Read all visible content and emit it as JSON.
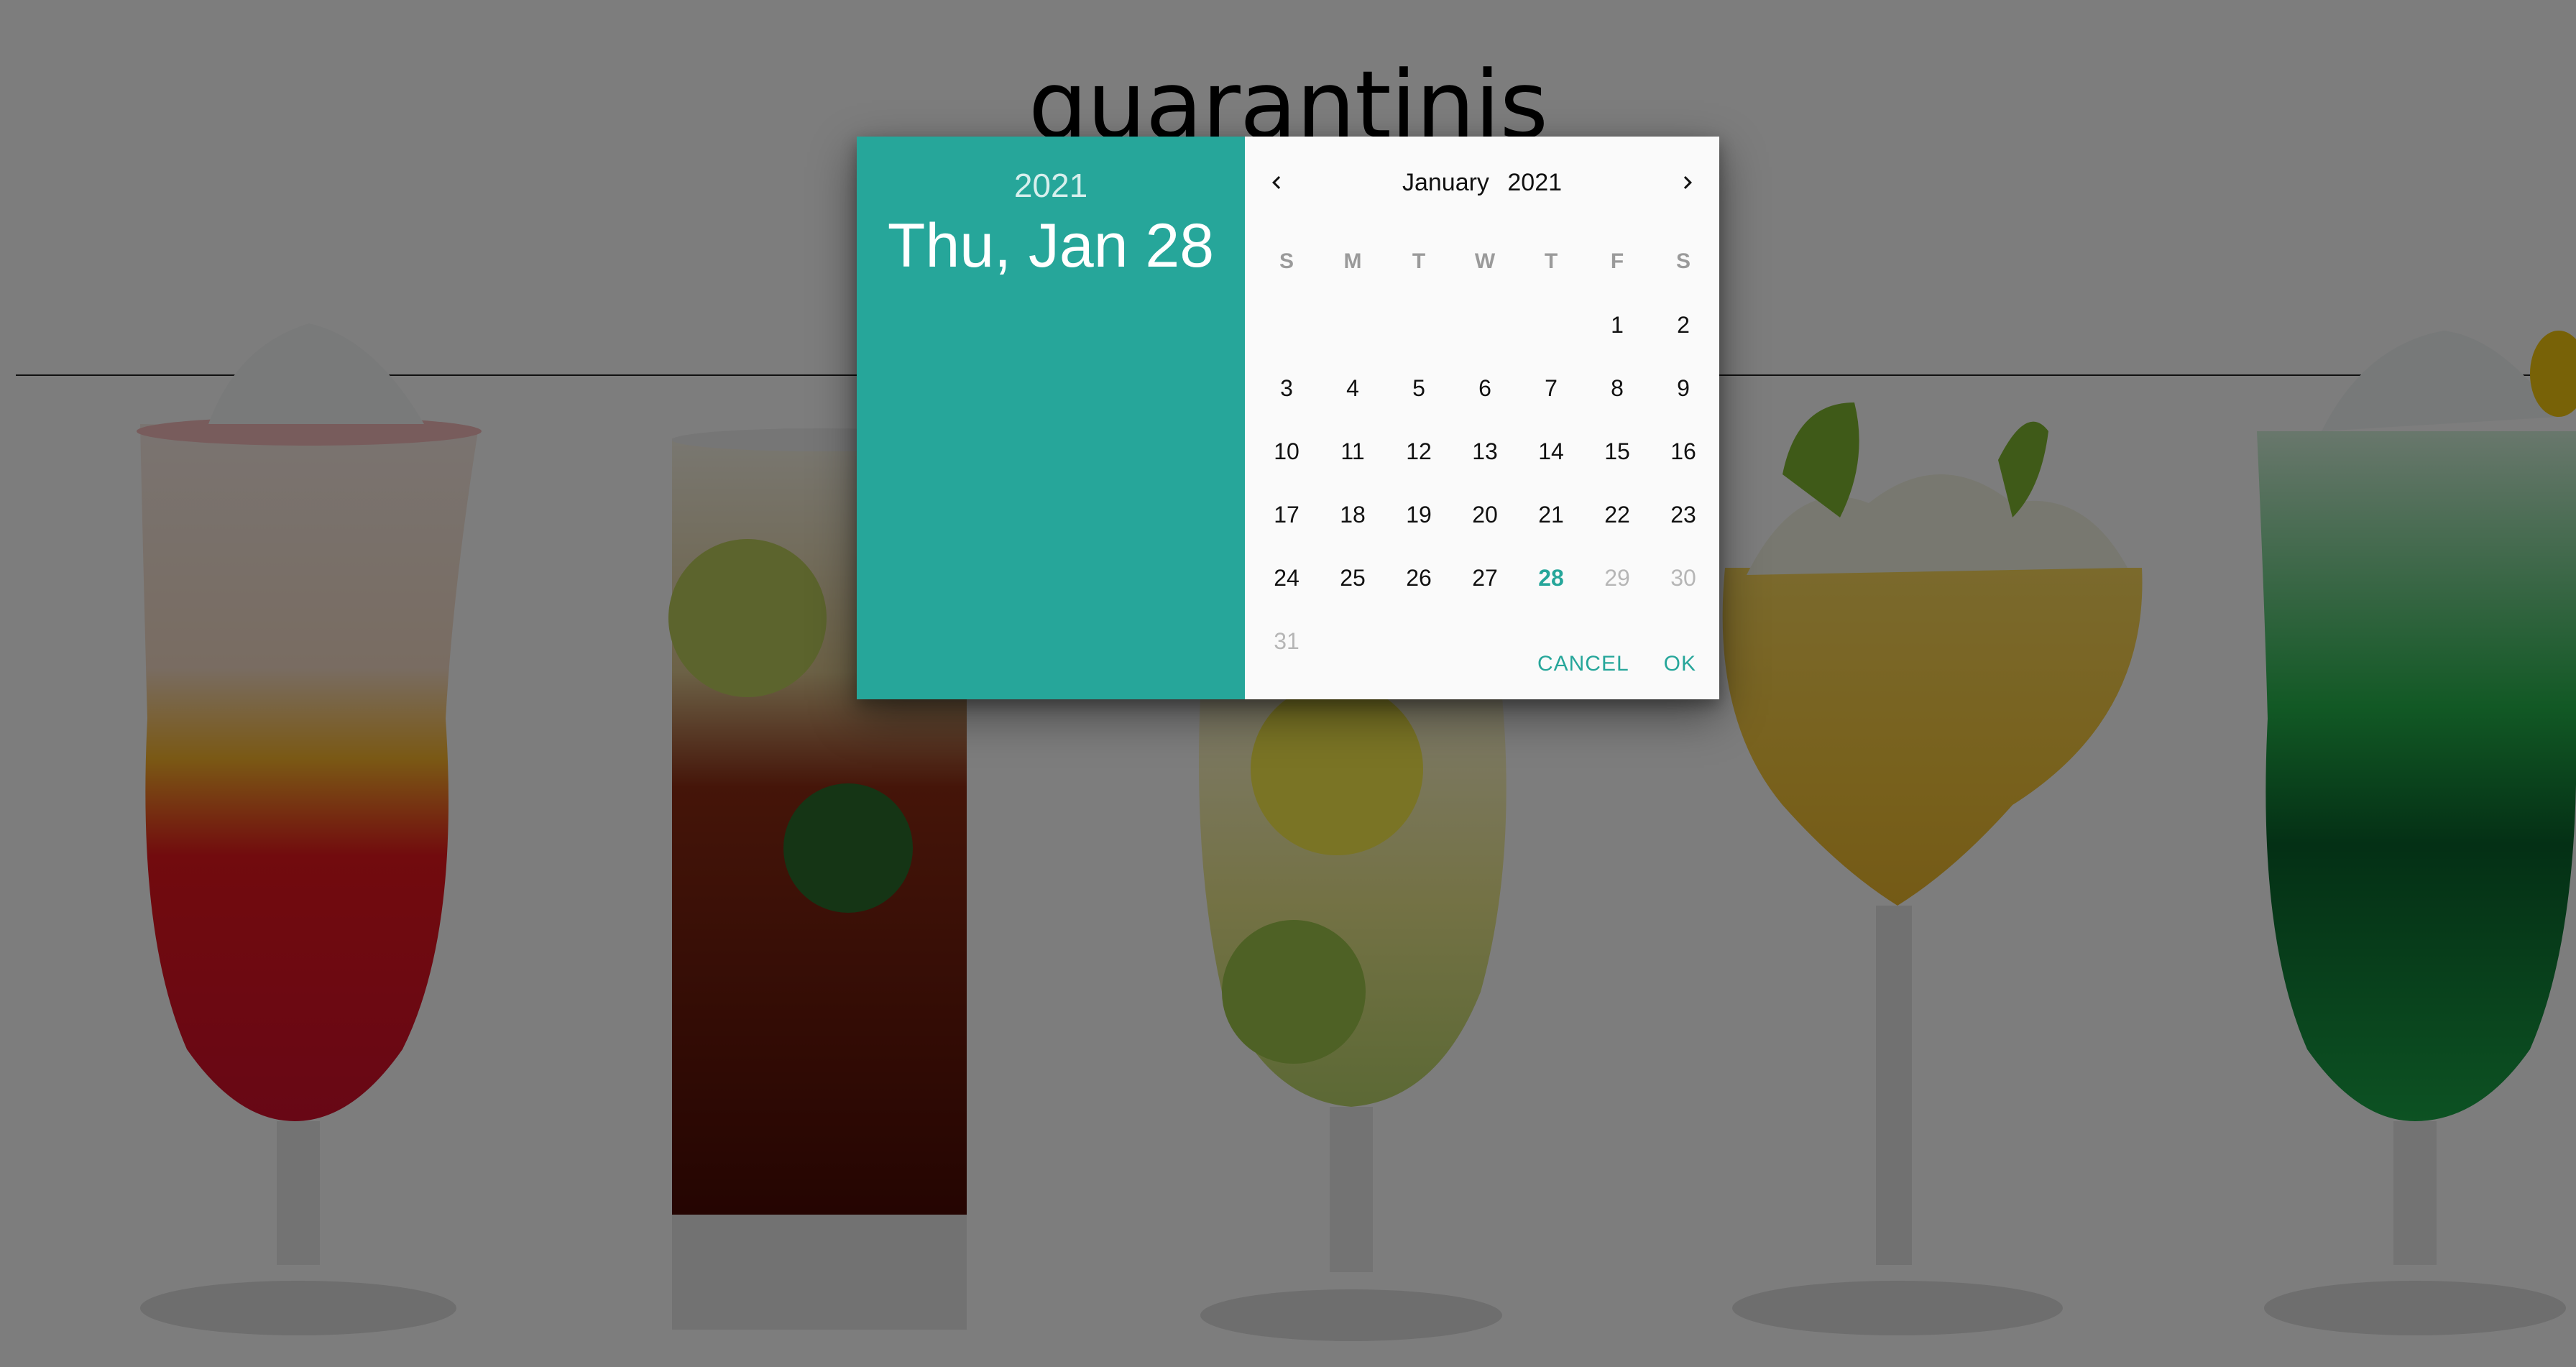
{
  "site": {
    "title": "quarantinis"
  },
  "datepicker": {
    "header_year": "2021",
    "header_date": "Thu, Jan 28",
    "month": "January",
    "year": "2021",
    "weekdays": [
      "S",
      "M",
      "T",
      "W",
      "T",
      "F",
      "S"
    ],
    "days": [
      {
        "label": ""
      },
      {
        "label": ""
      },
      {
        "label": ""
      },
      {
        "label": ""
      },
      {
        "label": ""
      },
      {
        "label": "1"
      },
      {
        "label": "2"
      },
      {
        "label": "3"
      },
      {
        "label": "4"
      },
      {
        "label": "5"
      },
      {
        "label": "6"
      },
      {
        "label": "7"
      },
      {
        "label": "8"
      },
      {
        "label": "9"
      },
      {
        "label": "10"
      },
      {
        "label": "11"
      },
      {
        "label": "12"
      },
      {
        "label": "13"
      },
      {
        "label": "14"
      },
      {
        "label": "15"
      },
      {
        "label": "16"
      },
      {
        "label": "17"
      },
      {
        "label": "18"
      },
      {
        "label": "19"
      },
      {
        "label": "20"
      },
      {
        "label": "21"
      },
      {
        "label": "22"
      },
      {
        "label": "23"
      },
      {
        "label": "24"
      },
      {
        "label": "25"
      },
      {
        "label": "26"
      },
      {
        "label": "27"
      },
      {
        "label": "28",
        "state": "selected"
      },
      {
        "label": "29",
        "state": "disabled"
      },
      {
        "label": "30",
        "state": "disabled"
      },
      {
        "label": "31",
        "state": "disabled"
      }
    ],
    "cancel_label": "CANCEL",
    "ok_label": "OK"
  },
  "colors": {
    "accent": "#26a69a",
    "backdrop": "rgba(0,0,0,0.5)"
  }
}
